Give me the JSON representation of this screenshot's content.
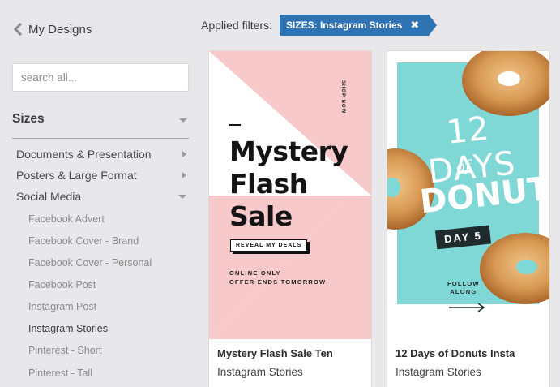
{
  "sidebar": {
    "back_label": "My Designs",
    "search_placeholder": "search all...",
    "section_title": "Sizes",
    "categories": [
      {
        "label": "Documents & Presentation"
      },
      {
        "label": "Posters & Large Format"
      },
      {
        "label": "Social Media"
      }
    ],
    "subitems": [
      {
        "label": "Facebook Advert"
      },
      {
        "label": "Facebook Cover - Brand"
      },
      {
        "label": "Facebook Cover - Personal"
      },
      {
        "label": "Facebook Post"
      },
      {
        "label": "Instagram Post"
      },
      {
        "label": "Instagram Stories"
      },
      {
        "label": "Pinterest - Short"
      },
      {
        "label": "Pinterest - Tall"
      }
    ]
  },
  "filters": {
    "label": "Applied filters:",
    "chip": "SIZES: Instagram Stories",
    "chip_close": "✖"
  },
  "cards": [
    {
      "name": "Mystery Flash Sale Ten",
      "type": "Instagram Stories",
      "thumb": {
        "shop": "SHOP NOW",
        "headline_1": "Mystery",
        "headline_2": "Flash",
        "headline_3": "Sale",
        "button": "REVEAL MY DEALS",
        "offer_1": "ONLINE ONLY",
        "offer_2": "OFFER ENDS TOMORROW"
      }
    },
    {
      "name": "12 Days of Donuts Insta",
      "type": "Instagram Stories",
      "thumb": {
        "days": "12 DAYS",
        "of": "of",
        "donut": "DONUT",
        "day_tag": "DAY 5",
        "follow_1": "FOLLOW",
        "follow_2": "ALONG"
      }
    }
  ],
  "colors": {
    "accent": "#3073b5",
    "pink": "#f7c9ca",
    "teal": "#7fd8d6",
    "donut": "#d89a54"
  }
}
